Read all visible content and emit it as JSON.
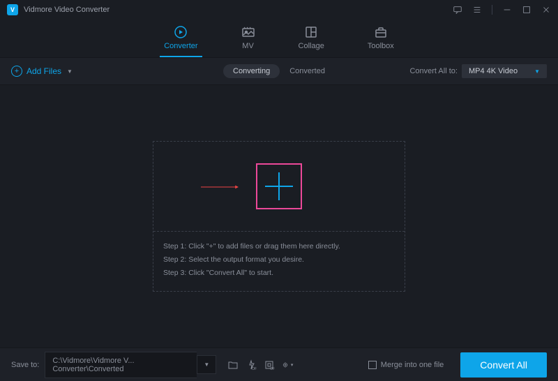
{
  "app": {
    "title": "Vidmore Video Converter"
  },
  "tabs": {
    "converter": "Converter",
    "mv": "MV",
    "collage": "Collage",
    "toolbox": "Toolbox"
  },
  "toolbar": {
    "add_files": "Add Files",
    "converting": "Converting",
    "converted": "Converted",
    "convert_all_to_label": "Convert All to:",
    "selected_format": "MP4 4K Video"
  },
  "steps": {
    "s1": "Step 1: Click \"+\" to add files or drag them here directly.",
    "s2": "Step 2: Select the output format you desire.",
    "s3": "Step 3: Click \"Convert All\" to start."
  },
  "bottom": {
    "save_to_label": "Save to:",
    "path": "C:\\Vidmore\\Vidmore V... Converter\\Converted",
    "merge_label": "Merge into one file",
    "convert_all": "Convert All"
  }
}
